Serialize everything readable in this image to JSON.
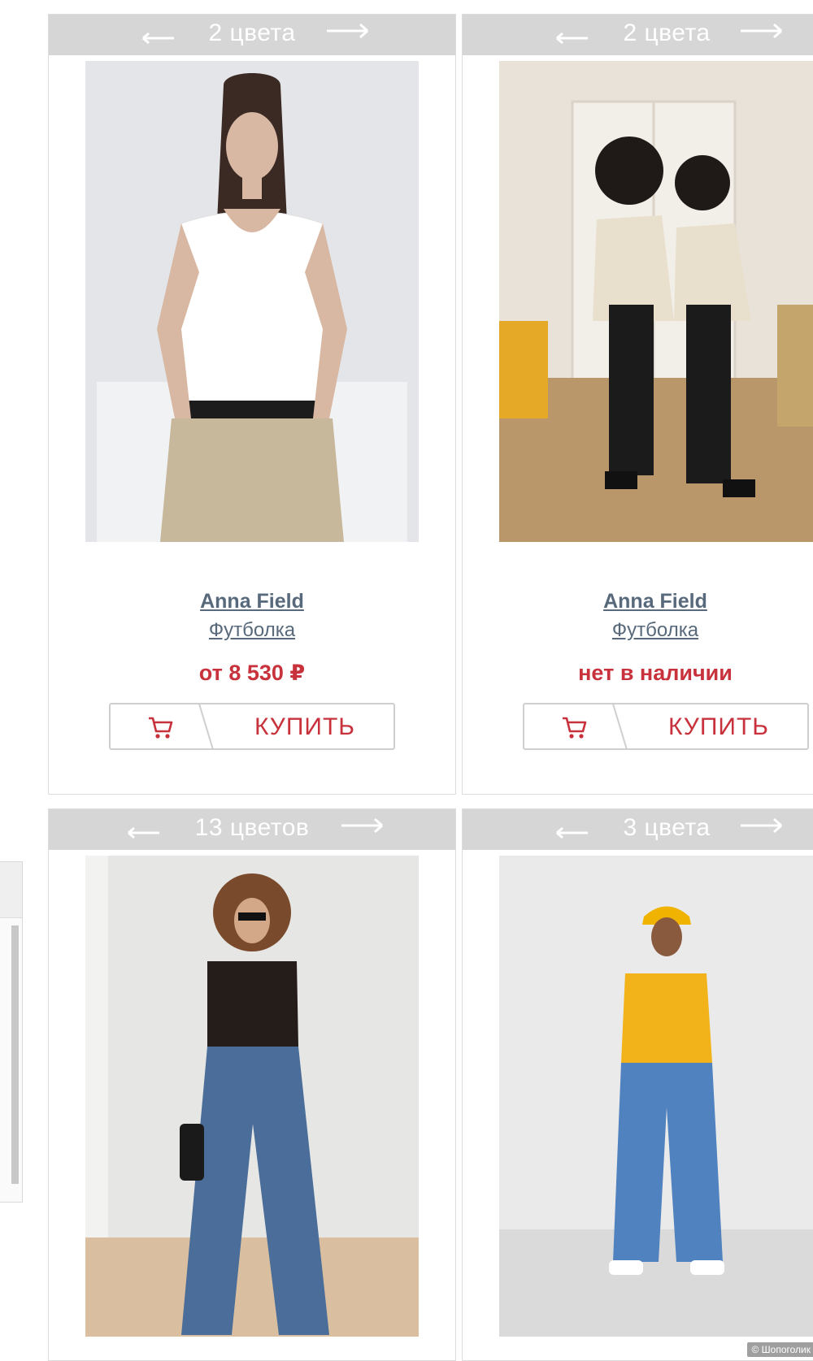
{
  "products": [
    {
      "colors_label": "2 цвета",
      "brand": "Anna Field",
      "type": "Футболка",
      "price": "от 8 530 ₽",
      "buy_label": "КУПИТЬ"
    },
    {
      "colors_label": "2 цвета",
      "brand": "Anna Field",
      "type": "Футболка",
      "price": "нет в наличии",
      "buy_label": "КУПИТЬ"
    },
    {
      "colors_label": "13 цветов"
    },
    {
      "colors_label": "3 цвета"
    }
  ],
  "watermark": "© Шопоголик",
  "colors": {
    "accent": "#c8323c",
    "link": "#57697a",
    "bar": "#d6d6d6"
  }
}
